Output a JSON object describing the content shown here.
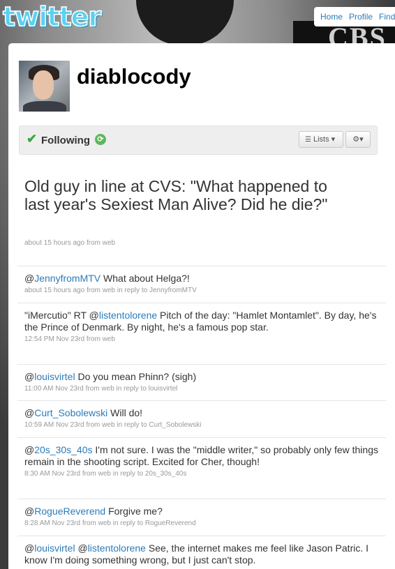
{
  "app": {
    "logo": "twitter"
  },
  "topnav": {
    "items": [
      "Home",
      "Profile",
      "Find"
    ]
  },
  "profile": {
    "screen_name": "diablocody"
  },
  "actions": {
    "following_label": "Following",
    "lists_label": "Lists",
    "check_icon": "check-icon",
    "refresh_icon": "refresh-icon",
    "gear_icon": "gear-icon"
  },
  "main_tweet": {
    "text": "Old guy in line at CVS: \"What happened to last year's Sexiest Man Alive? Did he die?\"",
    "meta": "about 15 hours ago from web"
  },
  "tweets": [
    {
      "segments": [
        {
          "t": "@",
          "m": false
        },
        {
          "t": "JennyfromMTV",
          "m": true
        },
        {
          "t": " What about Helga?!",
          "m": false
        }
      ],
      "meta": "about 15 hours ago from web in reply to JennyfromMTV",
      "height": 53
    },
    {
      "segments": [
        {
          "t": "\"iMercutio\" RT @",
          "m": false
        },
        {
          "t": "listentolorene",
          "m": true
        },
        {
          "t": " Pitch of the day: \"Hamlet Montamlet\". By day, he's the Prince of Denmark. By night, he's a famous pop star.",
          "m": false
        }
      ],
      "meta": "12:54 PM Nov 23rd from web",
      "height": 88
    },
    {
      "segments": [
        {
          "t": "@",
          "m": false
        },
        {
          "t": "louisvirtel",
          "m": true
        },
        {
          "t": " Do you mean Phinn? (sigh)",
          "m": false
        }
      ],
      "meta": "11:00 AM Nov 23rd from web in reply to louisvirtel",
      "height": 52
    },
    {
      "segments": [
        {
          "t": "@",
          "m": false
        },
        {
          "t": "Curt_Sobolewski",
          "m": true
        },
        {
          "t": " Will do!",
          "m": false
        }
      ],
      "meta": "10:59 AM Nov 23rd from web in reply to Curt_Sobolewski",
      "height": 53
    },
    {
      "segments": [
        {
          "t": "@",
          "m": false
        },
        {
          "t": "20s_30s_40s",
          "m": true
        },
        {
          "t": " I'm not sure. I was the \"middle writer,\" so probably only few things remain in the shooting script. Excited for Cher, though!",
          "m": false
        }
      ],
      "meta": "8:30 AM Nov 23rd from web in reply to 20s_30s_40s",
      "height": 88
    },
    {
      "segments": [
        {
          "t": "@",
          "m": false
        },
        {
          "t": "RogueReverend",
          "m": true
        },
        {
          "t": " Forgive me?",
          "m": false
        }
      ],
      "meta": "8:28 AM Nov 23rd from web in reply to RogueReverend",
      "height": 53
    },
    {
      "segments": [
        {
          "t": "@",
          "m": false
        },
        {
          "t": "louisvirtel",
          "m": true
        },
        {
          "t": " @",
          "m": false
        },
        {
          "t": "listentolorene",
          "m": true
        },
        {
          "t": " See, the internet makes me feel like Jason Patric. I know I'm doing something wrong, but I just can't stop.",
          "m": false
        }
      ],
      "meta": "",
      "height": 60
    }
  ]
}
